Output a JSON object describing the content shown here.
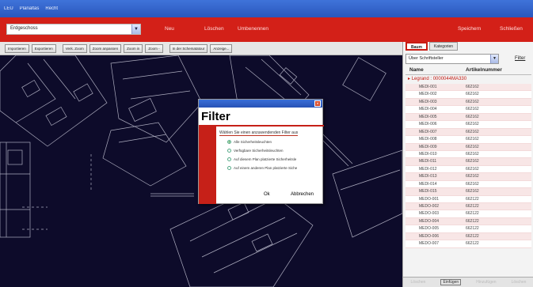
{
  "titlebar": {
    "items": [
      "LEU",
      "Planaltas",
      "Recht"
    ]
  },
  "redbar": {
    "combo_value": "Erdgeschoss",
    "links": {
      "neu": "Neu",
      "loeschen": "Löschen",
      "umbenennen": "Umbenennen",
      "speichern": "Speichern",
      "schliessen": "Schließen"
    }
  },
  "toolbar": {
    "buttons": [
      "Importieren",
      "Exportieren",
      "Verk. Zoom",
      "Zoom anpassen",
      "Zoom in",
      "Zoom -",
      "In der Schematatour",
      "Anzeige..."
    ]
  },
  "dialog": {
    "title": "Filter",
    "prompt": "Wählen Sie einen anzuwendenden Filter aus",
    "options": [
      "Alle Sicherheitsleuchten",
      "Verfügbare Sicherheitsleuchten",
      "Auf diesem Plan platzierte Sicherheitsle",
      "Auf einem anderen Plan platzierte Siche"
    ],
    "selected_index": 0,
    "ok_label": "Ok",
    "cancel_label": "Abbrechen"
  },
  "panel": {
    "tabs": [
      "Baum",
      "Kategorien"
    ],
    "select_value": "Über Schriftsteller",
    "filter_label": "Filter",
    "columns": [
      "Name",
      "Artikelnummer"
    ],
    "group_label": "Legrand : 0000044MA330",
    "rows": [
      [
        "MEDI-001",
        "662162"
      ],
      [
        "MEDI-002",
        "662162"
      ],
      [
        "MEDI-003",
        "662162"
      ],
      [
        "MEDI-004",
        "662162"
      ],
      [
        "MEDI-005",
        "662162"
      ],
      [
        "MEDI-006",
        "662162"
      ],
      [
        "MEDI-007",
        "662162"
      ],
      [
        "MEDI-008",
        "662162"
      ],
      [
        "MEDI-009",
        "662162"
      ],
      [
        "MEDI-010",
        "662162"
      ],
      [
        "MEDI-011",
        "662162"
      ],
      [
        "MEDI-012",
        "662162"
      ],
      [
        "MEDI-013",
        "662162"
      ],
      [
        "MEDI-014",
        "662162"
      ],
      [
        "MEDI-015",
        "662162"
      ],
      [
        "MEDO-001",
        "662122"
      ],
      [
        "MEDO-002",
        "662122"
      ],
      [
        "MEDO-003",
        "662122"
      ],
      [
        "MEDO-004",
        "662122"
      ],
      [
        "MEDO-005",
        "662122"
      ],
      [
        "MEDO-006",
        "662122"
      ],
      [
        "MEDO-007",
        "662122"
      ]
    ],
    "bottom": [
      "Löschen",
      "Einfügen",
      "Hinzufügen",
      "Löschen"
    ]
  },
  "colors": {
    "brand_red": "#d32018",
    "canvas_bg": "#0d0b2a"
  }
}
